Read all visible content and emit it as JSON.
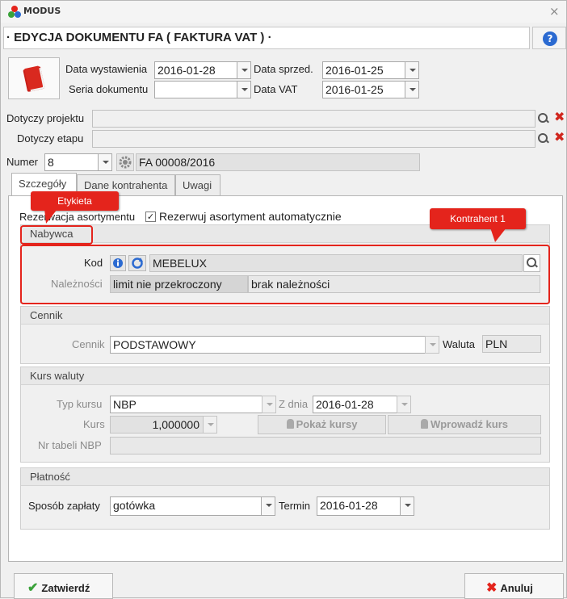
{
  "app": {
    "name": "MODUS",
    "close": "×"
  },
  "document_title": "· EDYCJA DOKUMENTU FA ( FAKTURA VAT ) ·",
  "help": "?",
  "header": {
    "data_wystawienia": {
      "label": "Data wystawienia",
      "value": "2016-01-28"
    },
    "data_sprzed": {
      "label": "Data sprzed.",
      "value": "2016-01-25"
    },
    "seria": {
      "label": "Seria dokumentu",
      "value": ""
    },
    "data_vat": {
      "label": "Data VAT",
      "value": "2016-01-25"
    },
    "projekt": {
      "label": "Dotyczy projektu",
      "value": ""
    },
    "etap": {
      "label": "Dotyczy etapu",
      "value": ""
    },
    "numer": {
      "label": "Numer",
      "value": "8",
      "full": "FA 00008/2016"
    }
  },
  "tabs": [
    {
      "label": "Szczegóły",
      "active": true
    },
    {
      "label": "Dane kontrahenta",
      "active": false
    },
    {
      "label": "Uwagi",
      "active": false
    }
  ],
  "rezerwacja": {
    "label": "Rezerwacja asortymentu",
    "checkbox_label": "Rezerwuj asortyment automatycznie",
    "checked": true,
    "check": "✓"
  },
  "nabywca": {
    "title": "Nabywca",
    "kod_label": "Kod",
    "kod_value": "MEBELUX",
    "naleznosci_label": "Należności",
    "limit": "limit nie przekroczony",
    "naleznosci": "brak należności"
  },
  "cennik": {
    "title": "Cennik",
    "label": "Cennik",
    "value": "PODSTAWOWY",
    "waluta_label": "Waluta",
    "waluta": "PLN"
  },
  "kurs": {
    "title": "Kurs waluty",
    "typ_label": "Typ kursu",
    "typ": "NBP",
    "zdnia_label": "Z dnia",
    "zdnia": "2016-01-28",
    "kurs_label": "Kurs",
    "kurs": "1,000000",
    "pokaz": "Pokaż kursy",
    "wprowadz": "Wprowadź kurs",
    "nrtabeli_label": "Nr tabeli NBP",
    "nrtabeli": ""
  },
  "platnosc": {
    "title": "Płatność",
    "sposob_label": "Sposób zapłaty",
    "sposob": "gotówka",
    "termin_label": "Termin",
    "termin": "2016-01-28"
  },
  "callouts": {
    "etykieta": "Etykieta",
    "kontrahent": "Kontrahent 1"
  },
  "buttons": {
    "ok": "Zatwierdź",
    "cancel": "Anuluj"
  },
  "colors": {
    "accent_red": "#e4241c",
    "help_blue": "#2b6ad1",
    "ok_green": "#3aa23a"
  }
}
